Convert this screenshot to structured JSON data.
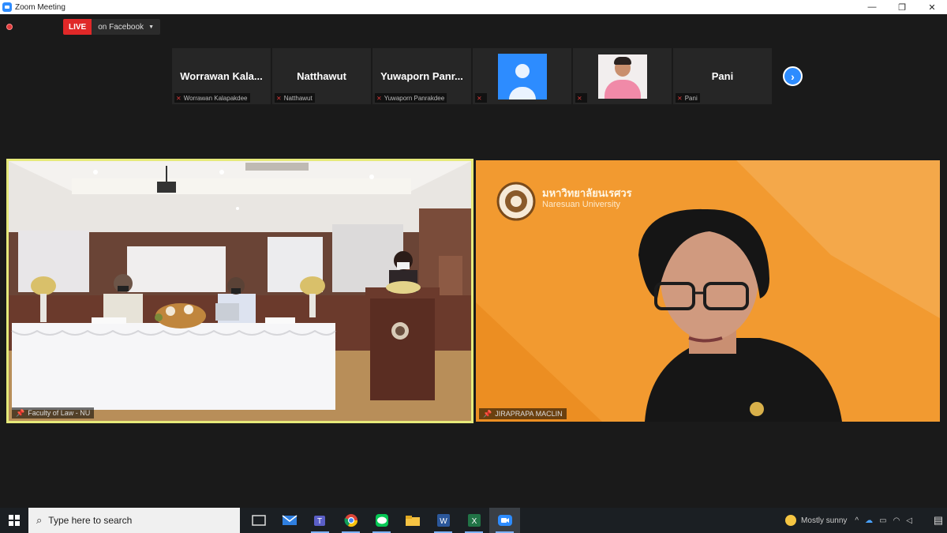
{
  "window": {
    "title": "Zoom Meeting",
    "minimize": "—",
    "maximize": "❐",
    "close": "✕"
  },
  "live": {
    "badge": "LIVE",
    "target": "on Facebook"
  },
  "participants": [
    {
      "name": "Worrawan  Kala...",
      "label": "Worrawan Kalapakdee"
    },
    {
      "name": "Natthawut",
      "label": "Natthawut"
    },
    {
      "name": "Yuwaporn Panr...",
      "label": "Yuwaporn Panrakdee"
    },
    {
      "name": "",
      "label": ""
    },
    {
      "name": "",
      "label": ""
    },
    {
      "name": "Pani",
      "label": "Pani"
    }
  ],
  "videos": {
    "left": {
      "label": "Faculty of Law - NU"
    },
    "right": {
      "label": "JIRAPRAPA MACLIN",
      "logo_th": "มหาวิทยาลัยนเรศวร",
      "logo_en": "Naresuan University"
    }
  },
  "taskbar": {
    "search_placeholder": "Type here to search"
  },
  "tray": {
    "weather": "Mostly sunny"
  },
  "colors": {
    "zoom_blue": "#2d8cff",
    "live_red": "#e02828",
    "active_border": "#e6ea7a",
    "orange_bg": "#f19a2e"
  }
}
